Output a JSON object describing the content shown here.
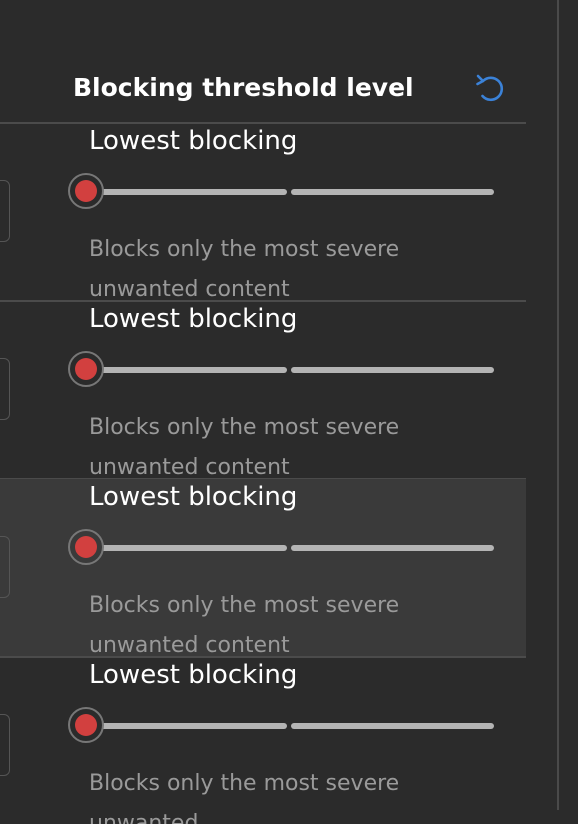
{
  "panel": {
    "title": "Blocking threshold level",
    "reset_icon": "reset-undo-icon",
    "accent_color": "#3b82d8"
  },
  "rows": [
    {
      "label": "Lowest blocking",
      "description": "Blocks only the most severe unwanted content",
      "slider_level": 0,
      "highlighted": false
    },
    {
      "label": "Lowest blocking",
      "description": "Blocks only the most severe unwanted content",
      "slider_level": 0,
      "highlighted": false
    },
    {
      "label": "Lowest blocking",
      "description": "Blocks only the most severe unwanted content",
      "slider_level": 0,
      "highlighted": true
    },
    {
      "label": "Lowest blocking",
      "description": "Blocks only the most severe unwanted",
      "slider_level": 0,
      "highlighted": false
    }
  ],
  "colors": {
    "background": "#2b2b2b",
    "highlight_row": "#3a3a3a",
    "thumb": "#d2403f",
    "track": "#b4b4b4"
  }
}
